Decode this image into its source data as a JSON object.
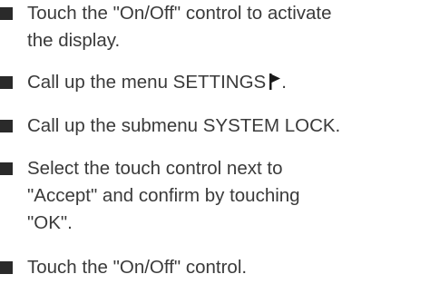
{
  "steps": [
    {
      "text": "Touch the \"On/Off\" control to activate\nthe display."
    },
    {
      "text": "Call up the menu SETTINGS",
      "icon": "flag-icon",
      "suffix": "."
    },
    {
      "text": "Call up the submenu SYSTEM LOCK."
    },
    {
      "text": "Select the touch control next to\n\"Accept\" and confirm by touching\n\"OK\"."
    },
    {
      "text": "Touch the \"On/Off\" control."
    }
  ]
}
